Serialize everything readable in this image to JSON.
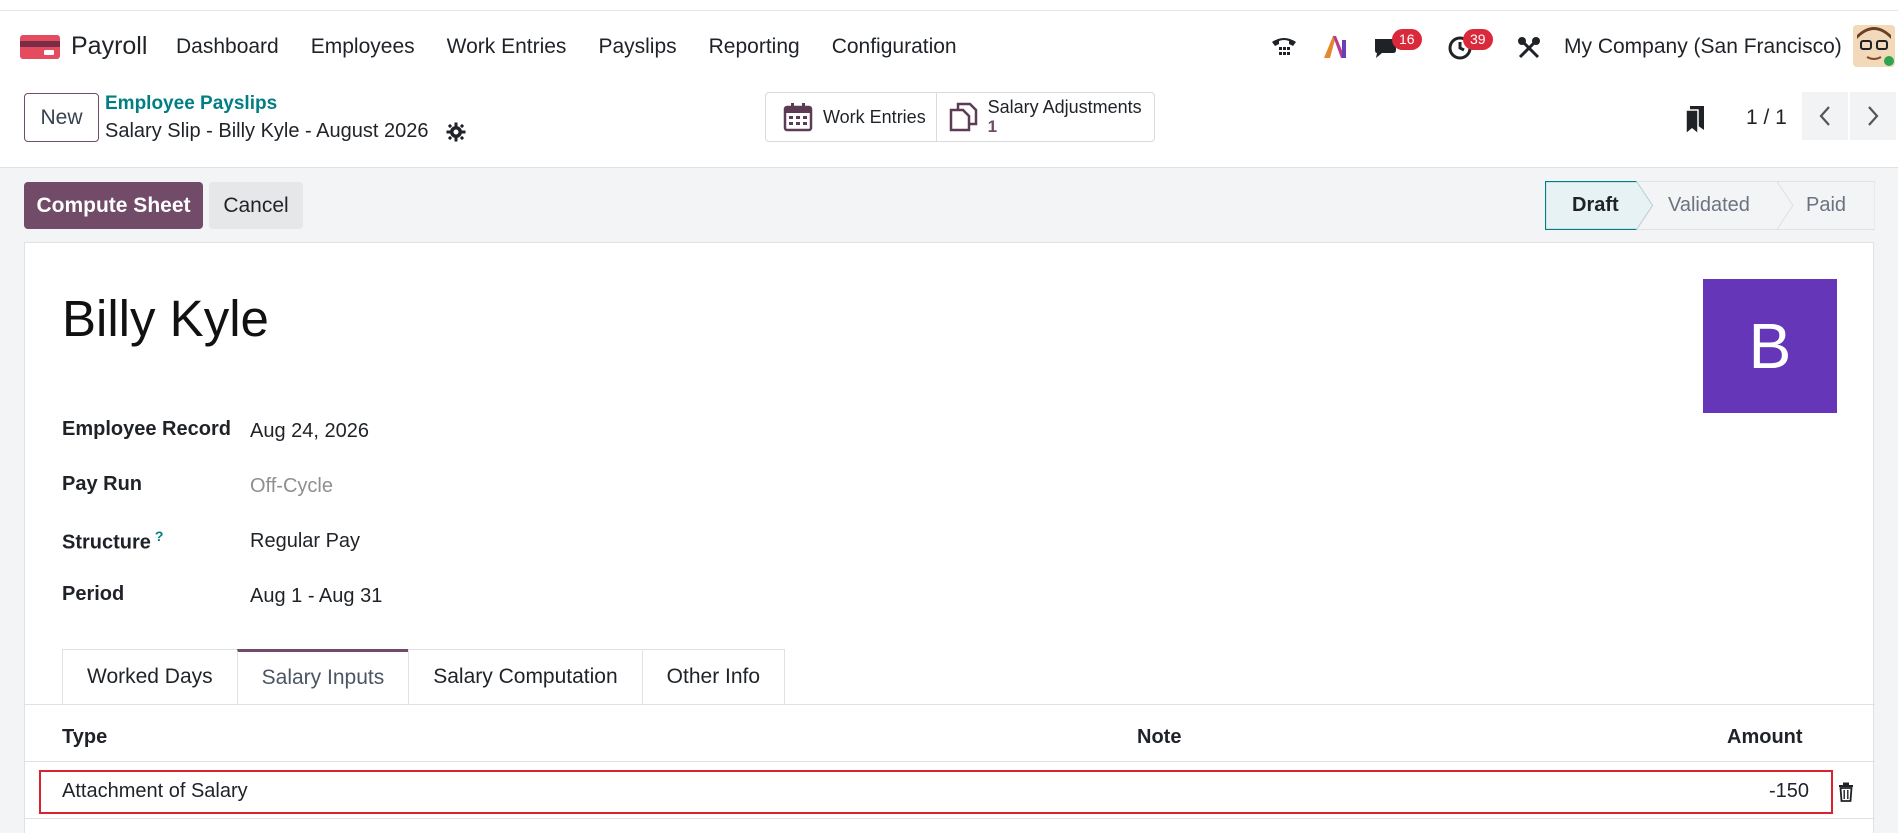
{
  "app": {
    "name": "Payroll"
  },
  "menu": [
    "Dashboard",
    "Employees",
    "Work Entries",
    "Payslips",
    "Reporting",
    "Configuration"
  ],
  "systray": {
    "chat_badge": "16",
    "activity_badge": "39",
    "company": "My Company (San Francisco)"
  },
  "breadcrumb": {
    "parent": "Employee Payslips",
    "current": "Salary Slip - Billy Kyle - August 2026"
  },
  "control": {
    "new_label": "New"
  },
  "smart_buttons": {
    "work_entries": "Work Entries",
    "salary_adjustments": "Salary Adjustments",
    "salary_adjustments_count": "1"
  },
  "pager": {
    "value": "1 / 1"
  },
  "actions": {
    "compute": "Compute Sheet",
    "cancel": "Cancel"
  },
  "status": {
    "steps": [
      "Draft",
      "Validated",
      "Paid"
    ],
    "current": "Draft"
  },
  "employee": {
    "name": "Billy Kyle",
    "initial": "B"
  },
  "fields": {
    "employee_record_label": "Employee Record",
    "employee_record": "Aug 24, 2026",
    "pay_run_label": "Pay Run",
    "pay_run": "Off-Cycle",
    "structure_label": "Structure",
    "structure": "Regular Pay",
    "period_label": "Period",
    "period": "Aug 1 - Aug 31"
  },
  "tabs": [
    "Worked Days",
    "Salary Inputs",
    "Salary Computation",
    "Other Info"
  ],
  "active_tab": "Salary Inputs",
  "table": {
    "headers": {
      "type": "Type",
      "note": "Note",
      "amount": "Amount"
    },
    "rows": [
      {
        "type": "Attachment of Salary",
        "note": "",
        "amount": "-150"
      }
    ]
  },
  "colors": {
    "brand": "#714b67",
    "teal": "#017e84",
    "avatar": "#6536b8",
    "highlight": "#d9232f"
  }
}
